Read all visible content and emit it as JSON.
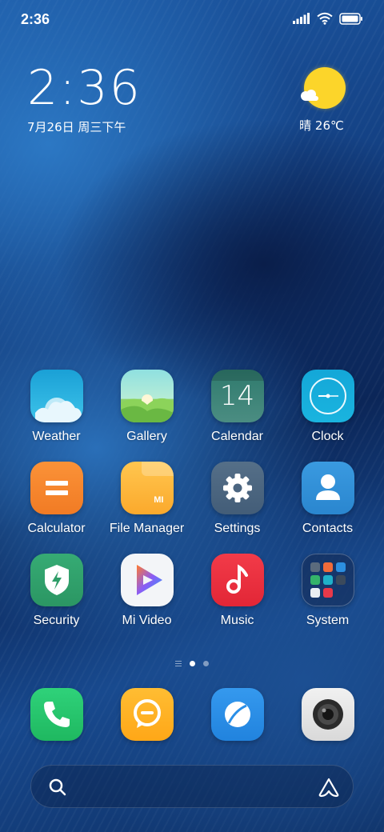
{
  "status_bar": {
    "time": "2:36"
  },
  "clock_widget": {
    "time": "2:36",
    "date": "7月26日 周三下午"
  },
  "weather_widget": {
    "condition_temp": "晴 26℃",
    "icon": "sun-cloud-icon"
  },
  "apps": [
    {
      "label": "Weather",
      "icon": "weather-icon"
    },
    {
      "label": "Gallery",
      "icon": "gallery-icon"
    },
    {
      "label": "Calendar",
      "icon": "calendar-icon",
      "day": "14"
    },
    {
      "label": "Clock",
      "icon": "clock-icon"
    },
    {
      "label": "Calculator",
      "icon": "calculator-icon"
    },
    {
      "label": "File Manager",
      "icon": "file-manager-icon",
      "badge": "MI"
    },
    {
      "label": "Settings",
      "icon": "gear-icon"
    },
    {
      "label": "Contacts",
      "icon": "contacts-icon"
    },
    {
      "label": "Security",
      "icon": "shield-icon"
    },
    {
      "label": "Mi Video",
      "icon": "play-icon"
    },
    {
      "label": "Music",
      "icon": "music-note-icon"
    },
    {
      "label": "System",
      "icon": "folder-icon"
    }
  ],
  "page_indicator": {
    "pages": 2,
    "current": 1
  },
  "dock": [
    {
      "name": "phone",
      "icon": "phone-icon"
    },
    {
      "name": "messaging",
      "icon": "message-icon"
    },
    {
      "name": "browser",
      "icon": "browser-icon"
    },
    {
      "name": "camera",
      "icon": "camera-icon"
    }
  ],
  "search_bar": {
    "left_icon": "search-icon",
    "right_icon": "assistant-icon"
  },
  "colors": {
    "weather": "#1fa8d8",
    "gallery": "#7fcf5a",
    "calendar": "#3d7f73",
    "clock": "#19a6d6",
    "calculator": "#f78a2e",
    "file_manager": "#fbb53c",
    "settings": "#4b6a86",
    "contacts": "#2f8fd8",
    "security": "#31a56c",
    "mi_video": "#f2f4f7",
    "music": "#ec2f3e",
    "phone": "#22c56a",
    "messaging": "#ffb21f",
    "browser": "#2a8fe8",
    "camera": "#e4e4e4",
    "sun": "#fcd52a"
  }
}
